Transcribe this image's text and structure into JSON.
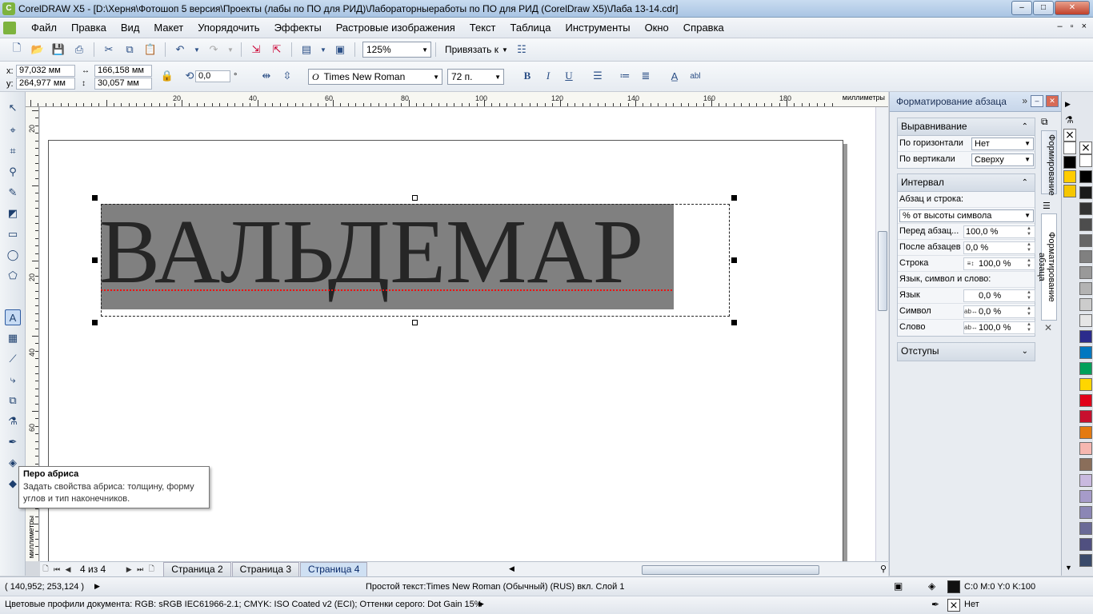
{
  "window": {
    "title": "CorelDRAW X5 - [D:\\Херня\\Фотошоп 5 версия\\Проекты (лабы по ПО для РИД)\\Лабораторныеработы по ПО для РИД (CorelDraw X5)\\Лаба 13-14.cdr]",
    "minimize": "–",
    "maximize": "□",
    "close": "✕"
  },
  "menu": {
    "items": [
      "Файл",
      "Правка",
      "Вид",
      "Макет",
      "Упорядочить",
      "Эффекты",
      "Растровые изображения",
      "Текст",
      "Таблица",
      "Инструменты",
      "Окно",
      "Справка"
    ],
    "right": [
      "–",
      "▫",
      "×"
    ]
  },
  "toolbar": {
    "zoom": "125%",
    "snap_label": "Привязать к"
  },
  "propbar": {
    "x_label": "x:",
    "x_value": "97,032 мм",
    "y_label": "y:",
    "y_value": "264,977 мм",
    "width_value": "166,158 мм",
    "height_value": "30,057 мм",
    "rotation_value": "0,0",
    "rotation_unit": "°",
    "font_name": "Times New Roman",
    "font_size": "72 п.",
    "bold": "B",
    "italic": "I",
    "underline": "U",
    "text_edit": "abl"
  },
  "rulers": {
    "h_labels": [
      "20",
      "40",
      "60",
      "80",
      "100",
      "120",
      "140",
      "160",
      "180"
    ],
    "v_labels": [
      "20",
      "20",
      "40",
      "60"
    ],
    "unit": "миллиметры"
  },
  "canvas": {
    "text": "ВАЛЬДЕМАР"
  },
  "tooltip": {
    "title": "Перо абриса",
    "body": "Задать свойства абриса: толщину, форму углов и тип наконечников."
  },
  "pages": {
    "count": "4 из 4",
    "tabs": [
      "Страница 2",
      "Страница 3",
      "Страница 4"
    ],
    "active": "Страница 4"
  },
  "docker": {
    "title": "Форматирование абзаца",
    "alignment": {
      "header": "Выравнивание",
      "horizontal_label": "По горизонтали",
      "horizontal_value": "Нет",
      "vertical_label": "По вертикали",
      "vertical_value": "Сверху"
    },
    "spacing": {
      "header": "Интервал",
      "para_line_label": "Абзац и строка:",
      "mode_value": "% от высоты символа",
      "before_label": "Перед абзац...",
      "before_value": "100,0 %",
      "after_label": "После абзацев",
      "after_value": "0,0 %",
      "line_label": "Строка",
      "line_value": "100,0 %",
      "lang_char_word_label": "Язык, символ и слово:",
      "language_label": "Язык",
      "language_value": "0,0 %",
      "char_label": "Символ",
      "char_value": "0,0 %",
      "word_label": "Слово",
      "word_value": "100,0 %"
    },
    "indents": {
      "header": "Отступы"
    },
    "side_tabs": [
      "Формирование",
      "Форматирование абзаца"
    ]
  },
  "palette": {
    "colors": [
      "#ffffff",
      "#000000",
      "#1a1a1a",
      "#333333",
      "#4d4d4d",
      "#666666",
      "#808080",
      "#999999",
      "#b3b3b3",
      "#cccccc",
      "#e6e6e6",
      "#2b2b8c",
      "#0077c0",
      "#00a05a",
      "#ffd600",
      "#e1001a",
      "#c8102e",
      "#e47a10",
      "#f6b7b0",
      "#8a6e5a",
      "#c9b9df",
      "#a69bc9",
      "#8b86b5",
      "#6a6a96",
      "#505080",
      "#3a4a6a"
    ]
  },
  "status": {
    "coords": "( 140,952; 253,124 )",
    "object_info": "Простой текст:Times New Roman (Обычный) (RUS) вкл. Слой 1",
    "fill_info": "C:0 M:0 Y:0 K:100",
    "color_profiles": "Цветовые профили документа: RGB: sRGB IEC61966-2.1; CMYK: ISO Coated v2 (ECI); Оттенки серого: Dot Gain 15%",
    "outline_info": "Нет"
  }
}
